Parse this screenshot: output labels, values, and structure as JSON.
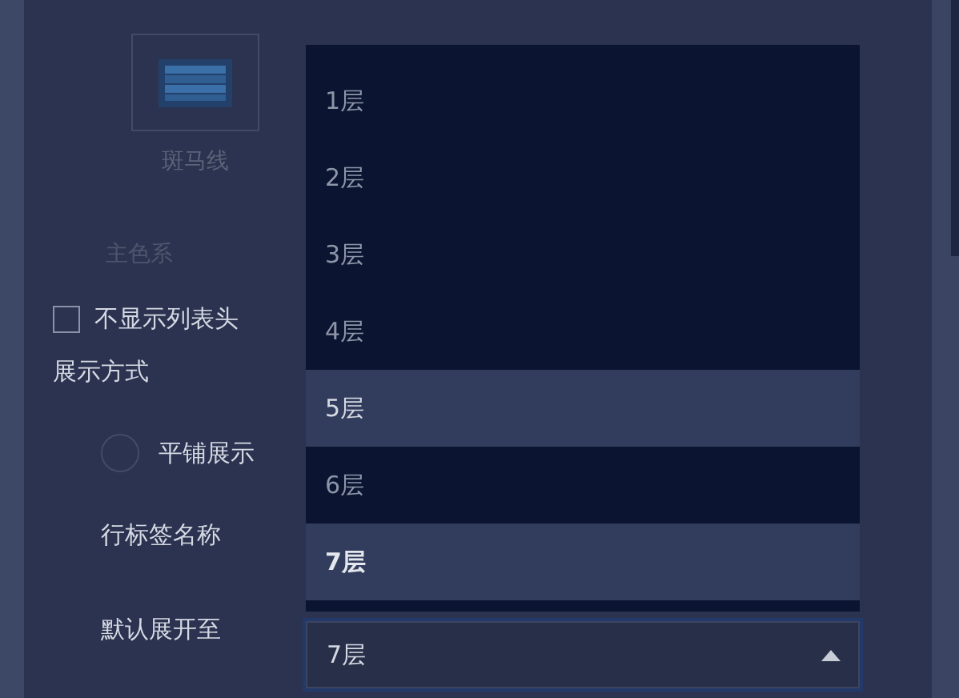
{
  "style_option": {
    "label": "斑马线",
    "selected": false
  },
  "main_color_label": "主色系",
  "hide_header": {
    "label": "不显示列表头",
    "checked": false
  },
  "display_mode_label": "展示方式",
  "display_mode": {
    "label": "平铺展示",
    "selected": false
  },
  "row_label_name": "行标签名称",
  "default_expand": {
    "label": "默认展开至",
    "value": "7层",
    "expanded": true
  },
  "dropdown_options": [
    {
      "label": "1层",
      "hovered": false,
      "selected": false
    },
    {
      "label": "2层",
      "hovered": false,
      "selected": false
    },
    {
      "label": "3层",
      "hovered": false,
      "selected": false
    },
    {
      "label": "4层",
      "hovered": false,
      "selected": false
    },
    {
      "label": "5层",
      "hovered": true,
      "selected": false
    },
    {
      "label": "6层",
      "hovered": false,
      "selected": false
    },
    {
      "label": "7层",
      "hovered": false,
      "selected": true
    }
  ]
}
